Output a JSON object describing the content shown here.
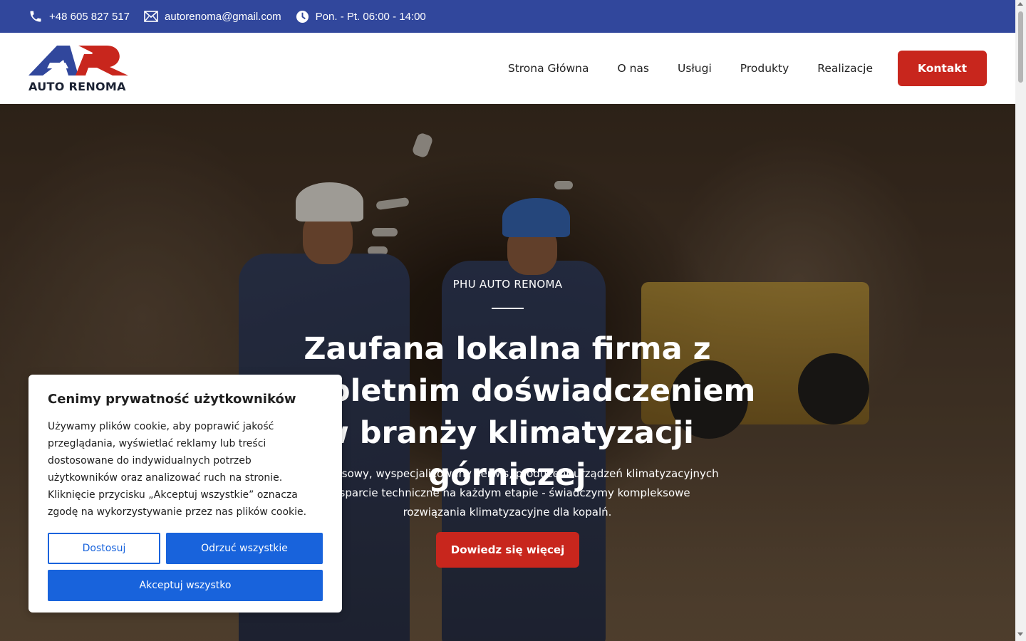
{
  "topbar": {
    "phone": "+48 605 827 517",
    "email": "autorenoma@gmail.com",
    "hours": "Pon. - Pt. 06:00 - 14:00",
    "bg_color": "#31479c"
  },
  "header": {
    "logo_text": "AUTO RENOMA",
    "nav": [
      {
        "label": "Strona Główna"
      },
      {
        "label": "O nas"
      },
      {
        "label": "Usługi"
      },
      {
        "label": "Produkty"
      },
      {
        "label": "Realizacje"
      }
    ],
    "cta_label": "Kontakt",
    "cta_color": "#c8261d"
  },
  "hero": {
    "eyebrow": "PHU AUTO RENOMA",
    "title": "Zaufana lokalna firma z wieloletnim doświadczeniem w branży klimatyzacji górniczej",
    "subtitle": "Kompleksowy, wyspecjalizowany serwis, producent urządzeń klimatyzacyjnych i wsparcie techniczne na każdym etapie - świadczymy kompleksowe rozwiązania klimatyzacyjne dla kopalń.",
    "button_label": "Dowiedz się więcej"
  },
  "cookie": {
    "title": "Cenimy prywatność użytkowników",
    "text": "Używamy plików cookie, aby poprawić jakość przeglądania, wyświetlać reklamy lub treści dostosowane do indywidualnych potrzeb użytkowników oraz analizować ruch na stronie. Kliknięcie przycisku „Akceptuj wszystkie” oznacza zgodę na wykorzystywanie przez nas plików cookie.",
    "customize_label": "Dostosuj",
    "reject_label": "Odrzuć wszystkie",
    "accept_label": "Akceptuj wszystko",
    "button_color": "#1863dc"
  }
}
